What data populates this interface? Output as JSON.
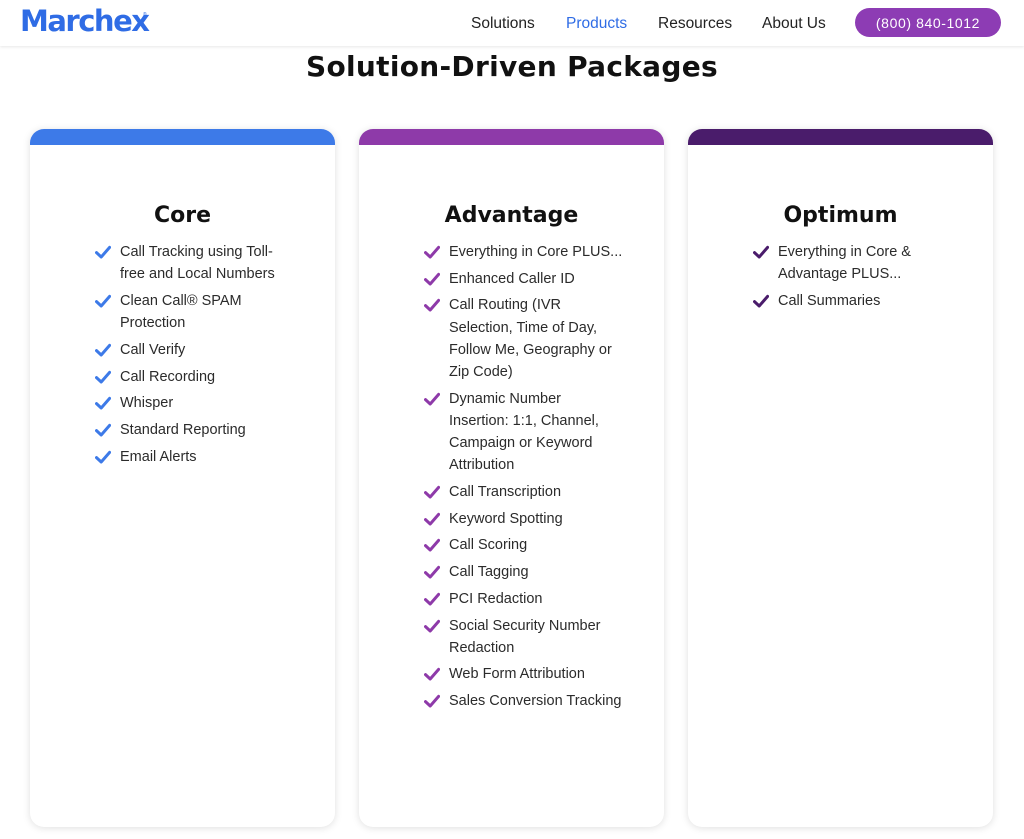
{
  "header": {
    "logo": "Marchex",
    "logo_tm": "®",
    "nav": {
      "solutions": "Solutions",
      "products": "Products",
      "resources": "Resources",
      "about": "About Us"
    },
    "phone": "(800) 840-1012"
  },
  "colors": {
    "brand_blue": "#2f6ce5",
    "brand_purple": "#8d3cb4",
    "core": "#3d7ae8",
    "advantage": "#8e3aa9",
    "optimum": "#4a1c6b"
  },
  "page_title": "Solution-Driven Packages",
  "packages": [
    {
      "name": "Core",
      "color": "#3d7ae8",
      "icon": "checkmark-icon",
      "features": [
        "Call Tracking using Toll-free and Local Numbers",
        "Clean Call® SPAM Protection",
        "Call Verify",
        "Call Recording",
        "Whisper",
        "Standard Reporting",
        "Email Alerts"
      ]
    },
    {
      "name": "Advantage",
      "color": "#8e3aa9",
      "icon": "checkmark-icon",
      "features": [
        "Everything in Core PLUS...",
        "Enhanced Caller ID",
        "Call Routing (IVR Selection, Time of Day, Follow Me, Geography or Zip Code)",
        "Dynamic Number Insertion: 1:1, Channel, Campaign or Keyword Attribution",
        "Call Transcription",
        "Keyword Spotting",
        "Call Scoring",
        "Call Tagging",
        "PCI Redaction",
        "Social Security Number Redaction",
        "Web Form Attribution",
        "Sales Conversion Tracking"
      ]
    },
    {
      "name": "Optimum",
      "color": "#4a1c6b",
      "icon": "checkmark-icon",
      "features": [
        "Everything in Core & Advantage PLUS...",
        "Call Summaries"
      ]
    }
  ]
}
